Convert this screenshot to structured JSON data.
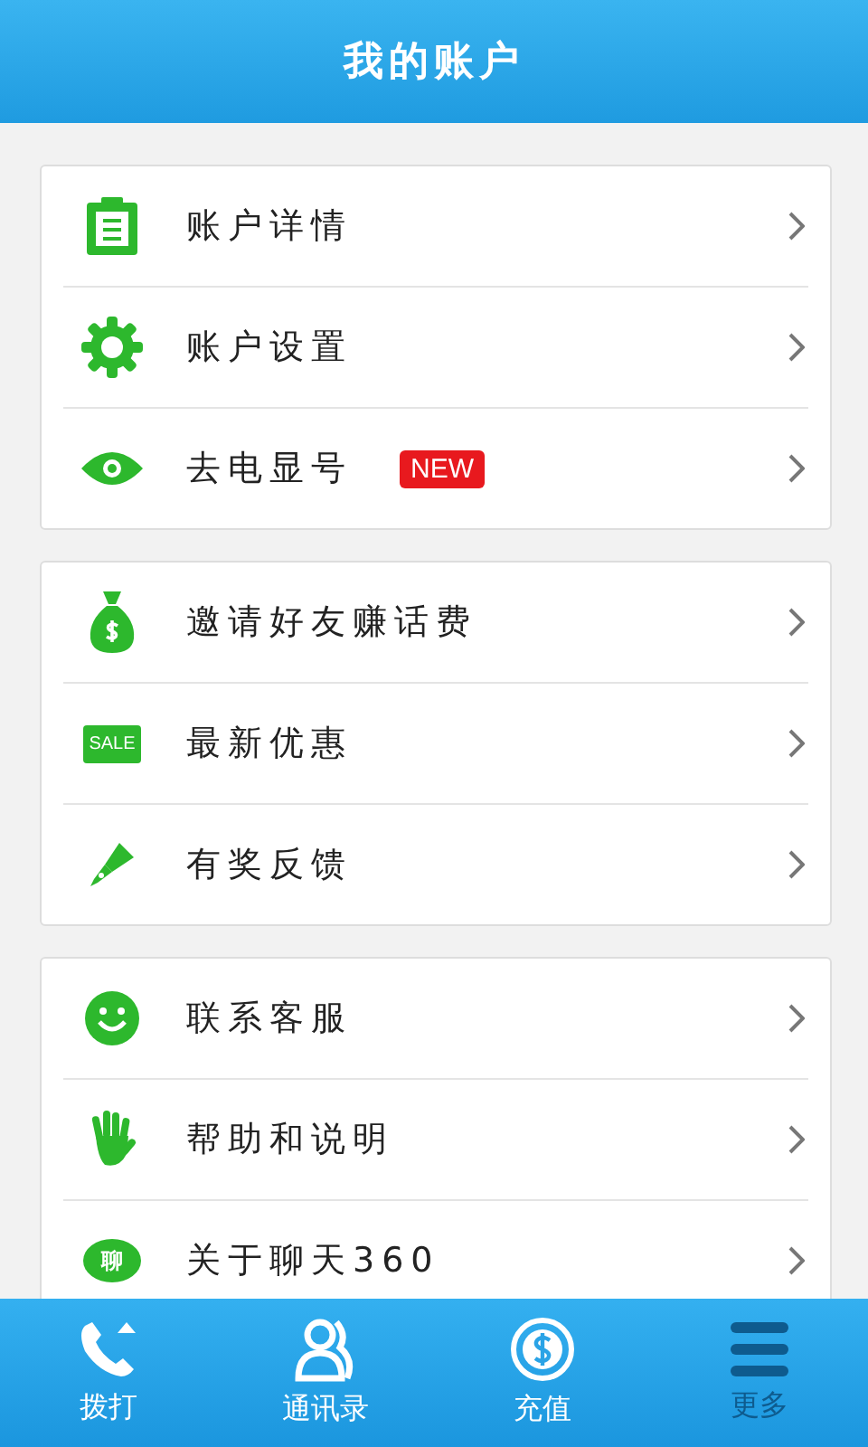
{
  "header": {
    "title": "我的账户"
  },
  "groups": [
    {
      "items": [
        {
          "kind": "clipboard",
          "label": "账户详情"
        },
        {
          "kind": "gear",
          "label": "账户设置"
        },
        {
          "kind": "eye",
          "label": "去电显号",
          "badge": "NEW"
        }
      ]
    },
    {
      "items": [
        {
          "kind": "moneybag",
          "label": "邀请好友赚话费"
        },
        {
          "kind": "sale",
          "label": "最新优惠",
          "icon_text": "SALE"
        },
        {
          "kind": "pen",
          "label": "有奖反馈"
        }
      ]
    },
    {
      "items": [
        {
          "kind": "smile",
          "label": "联系客服"
        },
        {
          "kind": "hand",
          "label": "帮助和说明"
        },
        {
          "kind": "bubble",
          "label": "关于聊天360",
          "icon_text": "聊"
        }
      ]
    }
  ],
  "tabs": [
    {
      "kind": "phone",
      "label": "拨打",
      "selected": false
    },
    {
      "kind": "contacts",
      "label": "通讯录",
      "selected": false
    },
    {
      "kind": "dollar",
      "label": "充值",
      "selected": false
    },
    {
      "kind": "menu",
      "label": "更多",
      "selected": true
    }
  ]
}
